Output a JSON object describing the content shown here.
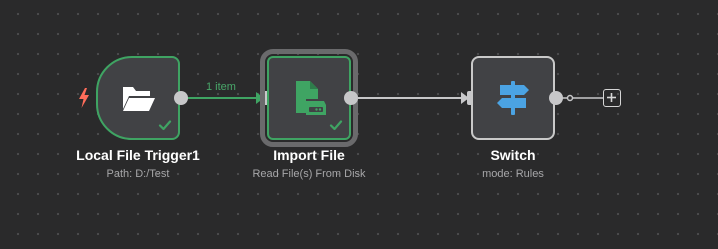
{
  "workflow": {
    "nodes": [
      {
        "name": "Local File Trigger1",
        "subtitle": "Path: D:/Test",
        "icon": "folder-open-icon",
        "status": "success"
      },
      {
        "name": "Import File",
        "subtitle": "Read File(s) From Disk",
        "icon": "file-disk-icon",
        "status": "success"
      },
      {
        "name": "Switch",
        "subtitle": "mode: Rules",
        "icon": "signpost-icon",
        "status": "idle"
      }
    ],
    "connections": [
      {
        "from": "Local File Trigger1",
        "to": "Import File",
        "label": "1 item"
      },
      {
        "from": "Import File",
        "to": "Switch",
        "label": ""
      }
    ]
  },
  "colors": {
    "canvas_background": "#2a2a2b",
    "canvas_dot": "#4b4b4d",
    "node_background": "#414245",
    "node_border": "#c9c9c9",
    "success": "#3fa463",
    "trigger_bolt": "#ff6d5a",
    "switch_icon": "#4ba3e3",
    "wire": "#c7c7c9"
  }
}
